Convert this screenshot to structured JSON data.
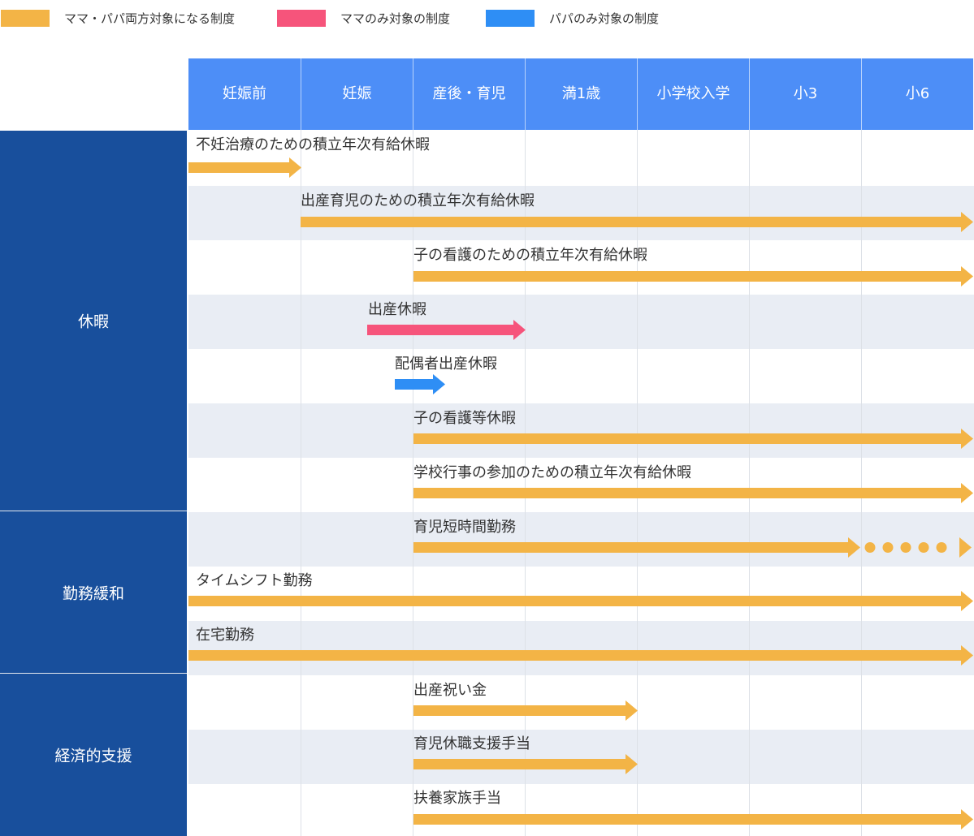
{
  "legend": [
    {
      "label": "ママ・パパ両方対象になる制度",
      "color": "#f3b446"
    },
    {
      "label": "ママのみ対象の制度",
      "color": "#f6547b"
    },
    {
      "label": "パパのみ対象の制度",
      "color": "#2e8ef5"
    }
  ],
  "columns": [
    "妊娠前",
    "妊娠",
    "産後・育児",
    "満1歳",
    "小学校入学",
    "小3",
    "小6"
  ],
  "categories": [
    {
      "label": "休暇"
    },
    {
      "label": "勤務緩和"
    },
    {
      "label": "経済的支援"
    }
  ],
  "rows": [
    {
      "label": "不妊治療のための積立年次有給休暇",
      "start": "妊娠前",
      "end": "妊娠",
      "target": "both"
    },
    {
      "label": "出産育児のための積立年次有給休暇",
      "start": "妊娠",
      "end": "小6",
      "target": "both",
      "open_end": true
    },
    {
      "label": "子の看護のための積立年次有給休暇",
      "start": "産後・育児",
      "end": "小6",
      "target": "both",
      "open_end": true
    },
    {
      "label": "出産休暇",
      "start": "妊娠",
      "end": "満1歳",
      "target": "mama"
    },
    {
      "label": "配偶者出産休暇",
      "start": "妊娠",
      "end": "産後・育児",
      "target": "papa"
    },
    {
      "label": "子の看護等休暇",
      "start": "産後・育児",
      "end": "小6",
      "target": "both",
      "open_end": true
    },
    {
      "label": "学校行事の参加のための積立年次有給休暇",
      "start": "産後・育児",
      "end": "小6",
      "target": "both",
      "open_end": true
    },
    {
      "label": "育児短時間勤務",
      "start": "産後・育児",
      "end": "小6",
      "target": "both",
      "dotted_after": "小6"
    },
    {
      "label": "タイムシフト勤務",
      "start": "妊娠前",
      "end": "小6",
      "target": "both",
      "open_end": true
    },
    {
      "label": "在宅勤務",
      "start": "妊娠前",
      "end": "小6",
      "target": "both",
      "open_end": true
    },
    {
      "label": "出産祝い金",
      "start": "産後・育児",
      "end": "満1歳",
      "target": "both"
    },
    {
      "label": "育児休職支援手当",
      "start": "産後・育児",
      "end": "満1歳",
      "target": "both"
    },
    {
      "label": "扶養家族手当",
      "start": "産後・育児",
      "end": "小6",
      "target": "both",
      "open_end": true
    }
  ]
}
